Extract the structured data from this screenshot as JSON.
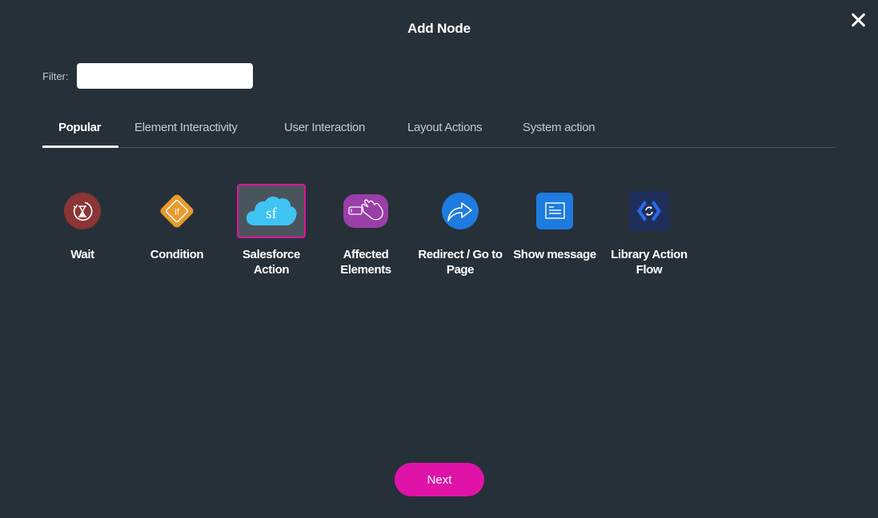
{
  "dialog": {
    "title": "Add Node",
    "close_icon": "close-icon"
  },
  "filter": {
    "label": "Filter:",
    "value": "",
    "placeholder": ""
  },
  "tabs": [
    {
      "label": "Popular",
      "active": true
    },
    {
      "label": "Element Interactivity",
      "active": false
    },
    {
      "label": "User Interaction",
      "active": false
    },
    {
      "label": "Layout Actions",
      "active": false
    },
    {
      "label": "System action",
      "active": false
    }
  ],
  "nodes": [
    {
      "label": "Wait",
      "icon": "hourglass-timer-icon",
      "color": "#8b3535",
      "selected": false
    },
    {
      "label": "Condition",
      "icon": "if-condition-icon",
      "color": "#e89a2e",
      "selected": false
    },
    {
      "label": "Salesforce Action",
      "icon": "salesforce-cloud-icon",
      "icon_text": "sf",
      "color": "#3fc3f2",
      "selected": true
    },
    {
      "label": "Affected Elements",
      "icon": "hand-pointer-element-icon",
      "color": "#9a3ea8",
      "selected": false
    },
    {
      "label": "Redirect / Go to Page",
      "icon": "redirect-arrow-icon",
      "color": "#1e7be0",
      "selected": false
    },
    {
      "label": "Show message",
      "icon": "message-box-icon",
      "color": "#1e7be0",
      "selected": false
    },
    {
      "label": "Library Action Flow",
      "icon": "code-refresh-icon",
      "color": "#1f2f5c",
      "selected": false
    }
  ],
  "footer": {
    "next_label": "Next"
  },
  "colors": {
    "background": "#263038",
    "accent": "#e013a8",
    "selected_border": "#e0129f"
  }
}
